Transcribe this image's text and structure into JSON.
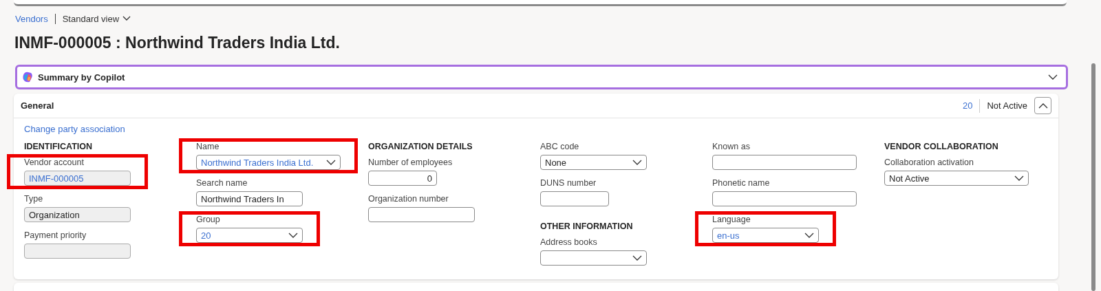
{
  "breadcrumb": {
    "link": "Vendors",
    "view": "Standard view"
  },
  "title": "INMF-000005 : Northwind Traders India Ltd.",
  "copilot": {
    "label": "Summary by Copilot",
    "expanded": false
  },
  "section": {
    "title": "General",
    "expanded": true,
    "summary": [
      {
        "text": "20",
        "kind": "link"
      },
      {
        "text": "Not Active",
        "kind": "plain"
      }
    ],
    "link": "Change party association",
    "columns": [
      [
        {
          "kind": "heading",
          "text": "IDENTIFICATION"
        },
        {
          "kind": "input",
          "label": "Vendor account",
          "value": "INMF-000005",
          "readonly": true,
          "link": true,
          "highlighted": true
        },
        {
          "kind": "input",
          "label": "Type",
          "value": "Organization",
          "readonly": true,
          "link": false,
          "highlighted": false
        },
        {
          "kind": "input",
          "label": "Payment priority",
          "readonly": true,
          "highlighted": false
        }
      ],
      [
        {
          "kind": "select",
          "label": "Name",
          "value": "Northwind Traders India Ltd.",
          "readonly": false,
          "link": true,
          "highlighted": true
        },
        {
          "kind": "input",
          "label": "Search name",
          "value": "Northwind Traders In",
          "readonly": false,
          "link": false,
          "highlighted": false
        },
        {
          "kind": "select",
          "label": "Group",
          "value": "20",
          "readonly": false,
          "link": true,
          "highlighted": true
        }
      ],
      [
        {
          "kind": "heading",
          "text": "ORGANIZATION DETAILS"
        },
        {
          "kind": "input",
          "label": "Number of employees",
          "value": "0",
          "numeric": true,
          "readonly": false,
          "link": false,
          "highlighted": false
        },
        {
          "kind": "input",
          "label": "Organization number",
          "readonly": false,
          "highlighted": false
        }
      ],
      [
        {
          "kind": "select",
          "label": "ABC code",
          "value": "None",
          "readonly": false,
          "link": false,
          "highlighted": false
        },
        {
          "kind": "input",
          "label": "DUNS number",
          "readonly": false,
          "highlighted": false
        },
        {
          "kind": "heading",
          "text": "OTHER INFORMATION"
        },
        {
          "kind": "select",
          "label": "Address books",
          "readonly": false,
          "highlighted": false
        }
      ],
      [
        {
          "kind": "input",
          "label": "Known as",
          "readonly": false,
          "highlighted": false
        },
        {
          "kind": "input",
          "label": "Phonetic name",
          "readonly": false,
          "highlighted": false
        },
        {
          "kind": "select",
          "label": "Language",
          "value": "en-us",
          "readonly": false,
          "link": true,
          "highlighted": true
        }
      ],
      [
        {
          "kind": "heading",
          "text": "VENDOR COLLABORATION"
        },
        {
          "kind": "select",
          "label": "Collaboration activation",
          "value": "Not Active",
          "readonly": false,
          "link": false,
          "highlighted": false
        }
      ]
    ]
  }
}
